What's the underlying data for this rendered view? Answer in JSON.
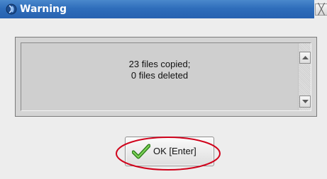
{
  "window": {
    "title": "Warning",
    "title_icon": "info-globe-icon",
    "close_glyph": "╳"
  },
  "message": {
    "line1": "23 files copied;",
    "line2": "0 files deleted"
  },
  "buttons": {
    "ok_label": "OK [Enter]",
    "ok_icon": "checkmark-icon"
  },
  "colors": {
    "titlebar": "#2f6ebb",
    "highlight_ring": "#d0021b",
    "check_green": "#3fa626"
  }
}
